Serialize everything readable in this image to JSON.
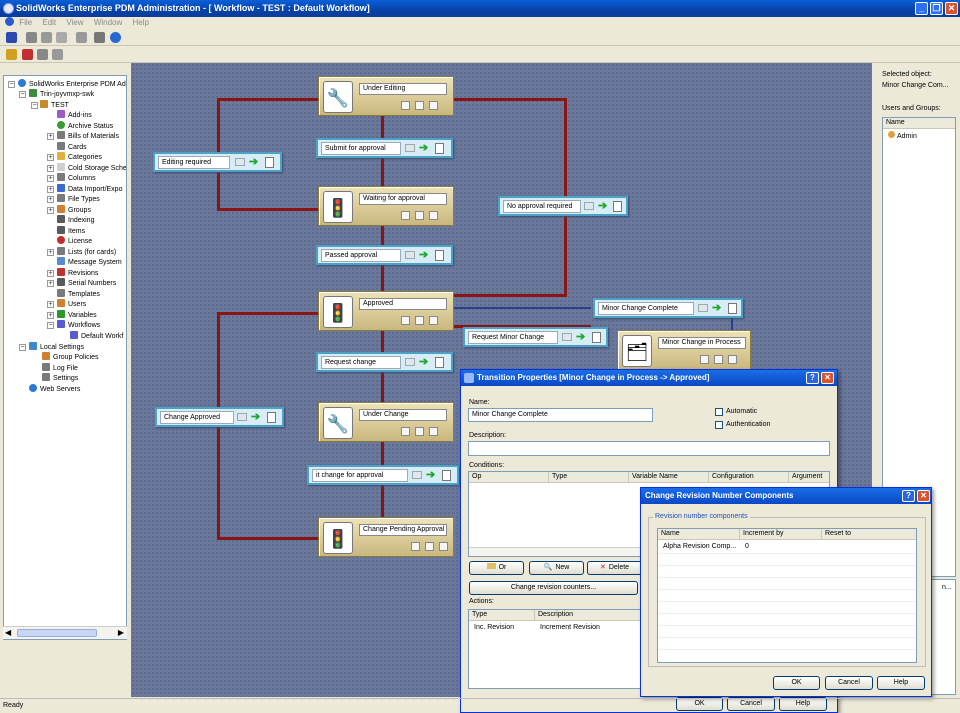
{
  "window": {
    "title": "SolidWorks Enterprise PDM Administration - [ Workflow - TEST : Default Workflow]"
  },
  "menu": [
    "File",
    "Edit",
    "View",
    "Window",
    "Help"
  ],
  "tree": [
    {
      "label": "SolidWorks Enterprise PDM Ad",
      "icon": "globe-icon",
      "color": "#2a7ad6"
    },
    {
      "label": "Trin-joyvmxp-swk",
      "icon": "server-icon",
      "color": "#3c8c3c"
    },
    {
      "label": "TEST",
      "icon": "vault-icon",
      "color": "#c88a2a"
    },
    {
      "label": "Add-ins",
      "icon": "addin-icon",
      "color": "#9a5bc9"
    },
    {
      "label": "Archive Status",
      "icon": "archive-icon",
      "color": "#3a9a3a"
    },
    {
      "label": "Bills of Materials",
      "icon": "bom-icon",
      "color": "#7a7a7a"
    },
    {
      "label": "Cards",
      "icon": "card-icon",
      "color": "#7a7a7a"
    },
    {
      "label": "Categories",
      "icon": "folder-icon",
      "color": "#e0b040"
    },
    {
      "label": "Cold Storage Sche",
      "icon": "doc-icon",
      "color": "#cfcfcf"
    },
    {
      "label": "Columns",
      "icon": "columns-icon",
      "color": "#7a7a7a"
    },
    {
      "label": "Data Import/Expo",
      "icon": "import-icon",
      "color": "#3a6ad0"
    },
    {
      "label": "File Types",
      "icon": "filetype-icon",
      "color": "#7a7a7a"
    },
    {
      "label": "Groups",
      "icon": "group-icon",
      "color": "#d08030"
    },
    {
      "label": "Indexing",
      "icon": "index-icon",
      "color": "#5a5a5a"
    },
    {
      "label": "Items",
      "icon": "item-icon",
      "color": "#5a5a5a"
    },
    {
      "label": "License",
      "icon": "license-icon",
      "color": "#c03030"
    },
    {
      "label": "Lists (for cards)",
      "icon": "list-icon",
      "color": "#7a7a7a"
    },
    {
      "label": "Message System",
      "icon": "message-icon",
      "color": "#5a8ad0"
    },
    {
      "label": "Revisions",
      "icon": "revision-icon",
      "color": "#c03030"
    },
    {
      "label": "Serial Numbers",
      "icon": "serial-icon",
      "color": "#5a5a5a"
    },
    {
      "label": "Templates",
      "icon": "template-icon",
      "color": "#7a7a7a"
    },
    {
      "label": "Users",
      "icon": "user-icon",
      "color": "#d08030"
    },
    {
      "label": "Variables",
      "icon": "variable-icon",
      "color": "#2a9a2a"
    },
    {
      "label": "Workflows",
      "icon": "workflow-icon",
      "color": "#5a5ad0"
    },
    {
      "label": "Default Workf",
      "icon": "workflow-icon",
      "color": "#5a5ad0"
    },
    {
      "label": "Local Settings",
      "icon": "settings-icon",
      "color": "#3a8ad0"
    },
    {
      "label": "Group Policies",
      "icon": "policy-icon",
      "color": "#d08030"
    },
    {
      "label": "Log File",
      "icon": "log-icon",
      "color": "#7a7a7a"
    },
    {
      "label": "Settings",
      "icon": "settings-icon",
      "color": "#7a7a7a"
    },
    {
      "label": "Web Servers",
      "icon": "web-icon",
      "color": "#2a7ad6"
    }
  ],
  "states": {
    "under_editing": "Under Editing",
    "waiting": "Waiting for approval",
    "approved": "Approved",
    "under_change": "Under Change",
    "change_pending": "Change Pending Approval",
    "minor_change": "Minor Change in Process"
  },
  "transitions": {
    "submit": "Submit for approval",
    "editing_required": "Editing required",
    "no_approval": "No approval required",
    "passed": "Passed approval",
    "minor_complete": "Minor Change Complete",
    "request_minor": "Request Minor Change",
    "request_change": "Request change",
    "change_approved": "Change Approved",
    "submit_change": "it change for approval"
  },
  "right_panel": {
    "selected_label": "Selected object:",
    "selected_value": "Minor Change Com...",
    "users_label": "Users and Groups:",
    "col_name": "Name",
    "user": "Admin",
    "cut_text": "n..."
  },
  "transition_dialog": {
    "title": "Transition Properties [Minor Change in Process -> Approved]",
    "name_label": "Name:",
    "name_value": "Minor Change Complete",
    "automatic": "Automatic",
    "authentication": "Authentication",
    "description_label": "Description:",
    "conditions_label": "Conditions:",
    "cond_cols": [
      "Op",
      "Type",
      "Variable Name",
      "Configuration",
      "Argument"
    ],
    "or_btn": "Or",
    "new_btn": "New",
    "delete_btn": "Delete",
    "revision_btn": "Change revision counters...",
    "actions_label": "Actions:",
    "action_cols": [
      "Type",
      "Description"
    ],
    "action_type": "Inc. Revision",
    "action_desc": "Increment Revision",
    "ok": "OK",
    "cancel": "Cancel",
    "help": "Help"
  },
  "revision_dialog": {
    "title": "Change Revision Number Components",
    "group_label": "Revision number components",
    "cols": [
      "Name",
      "Increment by",
      "Reset to"
    ],
    "row_name": "Alpha Revision Comp...",
    "row_inc": "0",
    "ok": "OK",
    "cancel": "Cancel",
    "help": "Help"
  },
  "status": "Ready"
}
